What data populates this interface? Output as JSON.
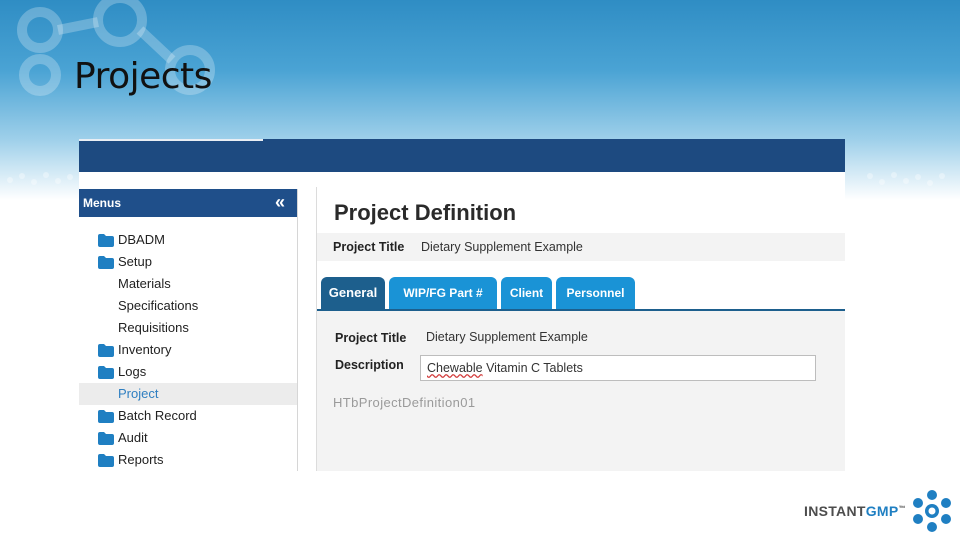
{
  "slide": {
    "title": "Projects"
  },
  "sidebar": {
    "title": "Menus",
    "collapse_icon": "double-chevron-left-icon",
    "items": [
      {
        "label": "DBADM",
        "icon": "folder-icon"
      },
      {
        "label": "Setup",
        "icon": "folder-icon"
      },
      {
        "label": "Materials",
        "icon": ""
      },
      {
        "label": "Specifications",
        "icon": ""
      },
      {
        "label": "Requisitions",
        "icon": ""
      },
      {
        "label": "Inventory",
        "icon": "folder-icon"
      },
      {
        "label": "Logs",
        "icon": "folder-icon"
      },
      {
        "label": "Project",
        "icon": "",
        "selected": true
      },
      {
        "label": "Batch Record",
        "icon": "folder-icon"
      },
      {
        "label": "Audit",
        "icon": "folder-icon"
      },
      {
        "label": "Reports",
        "icon": "folder-icon"
      }
    ]
  },
  "main": {
    "title": "Project Definition",
    "project_title_label": "Project Title",
    "project_title_value": "Dietary Supplement Example",
    "tabs": [
      {
        "label": "General",
        "active": true
      },
      {
        "label": "WIP/FG Part #",
        "active": false
      },
      {
        "label": "Client",
        "active": false
      },
      {
        "label": "Personnel",
        "active": false
      }
    ],
    "form": {
      "project_title_label": "Project Title",
      "project_title_value": "Dietary Supplement Example",
      "description_label": "Description",
      "description_value_word1": "Chewable",
      "description_value_rest": " Vitamin C Tablets",
      "control_id": "HTbProjectDefinition01"
    }
  },
  "logo": {
    "text_main": "INSTANT",
    "text_accent": "GMP",
    "trademark": "™"
  },
  "colors": {
    "nav_bar": "#1d4a80",
    "tab": "#1a93d6",
    "tab_active": "#1d5f8d",
    "selected_menu_text": "#2f7fc1",
    "logo_accent": "#1f7fc2"
  }
}
